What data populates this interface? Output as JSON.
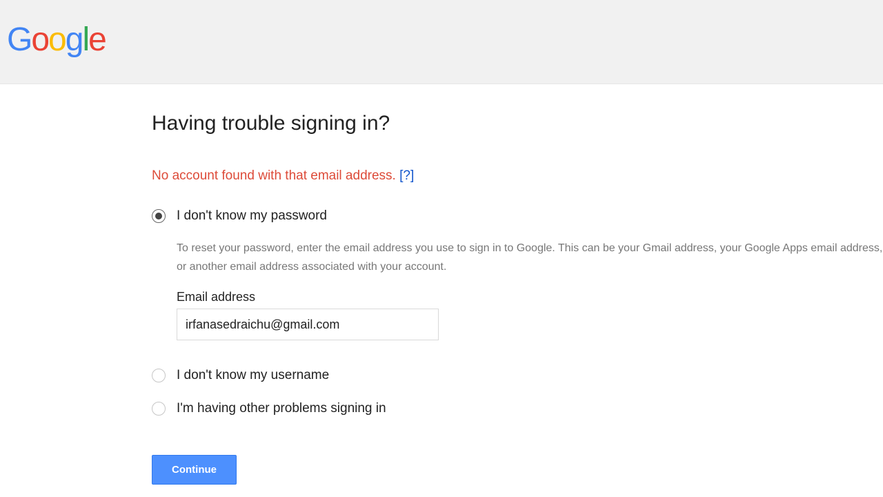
{
  "logo": {
    "g1": "G",
    "o1": "o",
    "o2": "o",
    "g2": "g",
    "l": "l",
    "e": "e"
  },
  "page": {
    "title": "Having trouble signing in?",
    "error_message": "No account found with that email address. ",
    "help_link": "[?]"
  },
  "options": {
    "password": {
      "label": "I don't know my password",
      "help": "To reset your password, enter the email address you use to sign in to Google. This can be your Gmail address, your Google Apps email address, or another email address associated with your account.",
      "field_label": "Email address",
      "field_value": "irfanasedraichu@gmail.com"
    },
    "username": {
      "label": "I don't know my username"
    },
    "other": {
      "label": "I'm having other problems signing in"
    }
  },
  "actions": {
    "continue": "Continue"
  }
}
